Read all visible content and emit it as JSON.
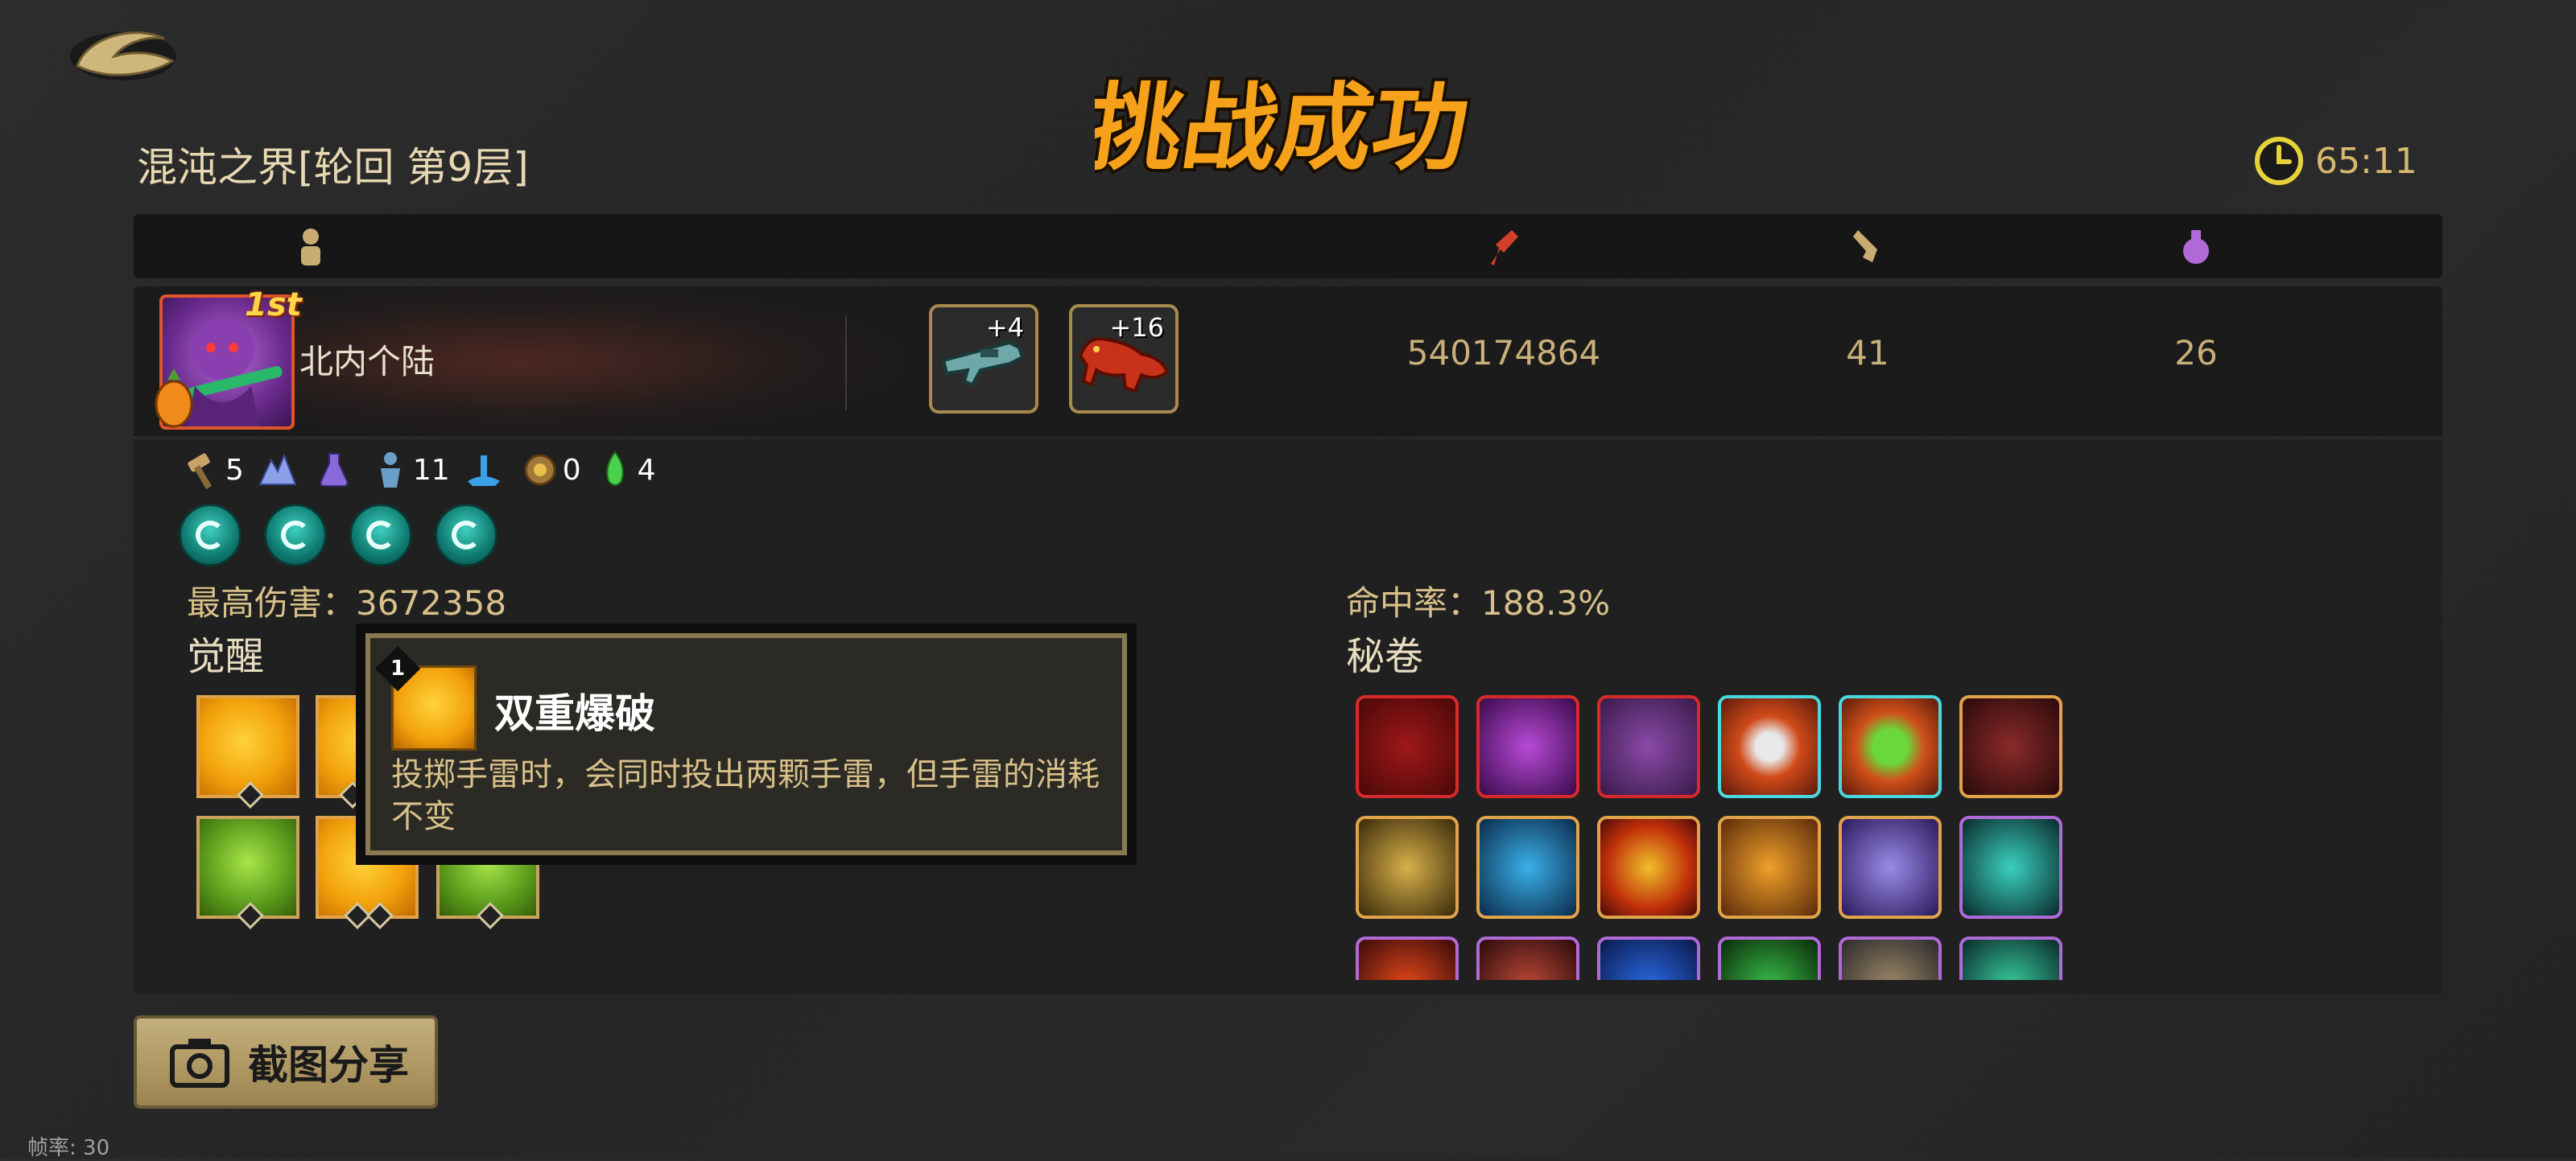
{
  "title_banner": "挑战成功",
  "stage_title": "混沌之界[轮回  第9层]",
  "timer": "65:11",
  "header": {
    "columns": [
      {
        "icon": "player-icon",
        "color": "#c9ac72"
      },
      {
        "icon": "damage-icon",
        "color": "#d0402a"
      },
      {
        "icon": "scroll-icon",
        "color": "#c9ac72"
      },
      {
        "icon": "potion-icon",
        "color": "#b06ad8"
      }
    ]
  },
  "player": {
    "rank": "1st",
    "name": "北内个陆",
    "equipment": [
      {
        "name": "weapon-gun",
        "level": "+4"
      },
      {
        "name": "pet-lizard",
        "level": "+16"
      }
    ],
    "damage": "540174864",
    "scrolls": "41",
    "potions": "26"
  },
  "resources": [
    {
      "icon": "hammer-icon",
      "count": "5"
    },
    {
      "icon": "crystal-icon",
      "count": ""
    },
    {
      "icon": "flask-icon",
      "count": ""
    },
    {
      "icon": "statue-icon",
      "count": "11"
    },
    {
      "icon": "fountain-icon",
      "count": ""
    },
    {
      "icon": "gear-chest-icon",
      "count": "0"
    },
    {
      "icon": "green-potion-icon",
      "count": "4"
    }
  ],
  "skills": [
    "skill-vortex",
    "skill-orb",
    "skill-slash",
    "skill-dash"
  ],
  "stats": {
    "max_damage_label": "最高伤害：",
    "max_damage_value": "3672358",
    "hit_rate_label": "命中率：",
    "hit_rate_value": "188.3%"
  },
  "awakening": {
    "title": "觉醒"
  },
  "tooltip": {
    "badge": "1",
    "title": "双重爆破",
    "description": "投掷手雷时，会同时投出两颗手雷，但手雷的消耗不变"
  },
  "secret_scrolls": {
    "title": "秘卷"
  },
  "share_button": "截图分享",
  "fps": "帧率: 30"
}
